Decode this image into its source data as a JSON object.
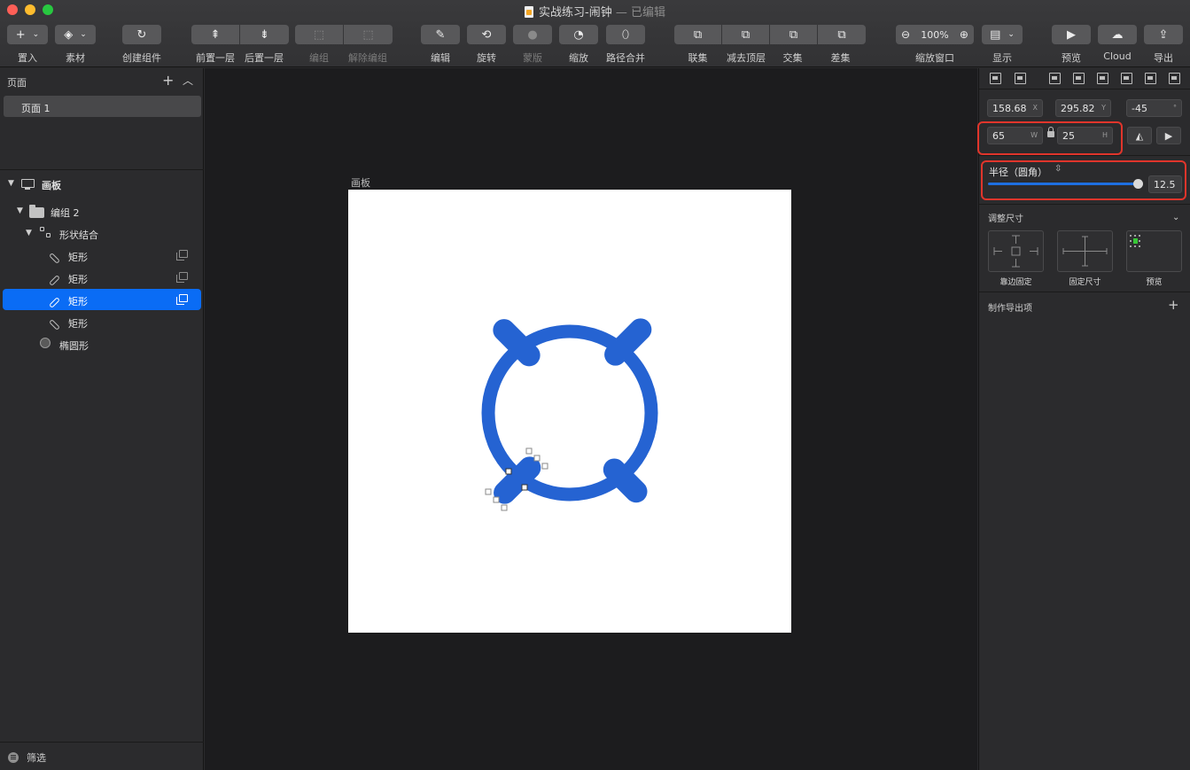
{
  "window": {
    "title": "实战练习-闹钟",
    "status": "— 已编辑"
  },
  "toolbar": {
    "insert": "置入",
    "assets": "素材",
    "create_symbol": "创建组件",
    "forward": "前置一层",
    "backward": "后置一层",
    "group": "编组",
    "ungroup": "解除编组",
    "edit": "编辑",
    "rotate": "旋转",
    "mask": "蒙版",
    "scale": "缩放",
    "flatten": "路径合并",
    "union": "联集",
    "subtract": "减去顶层",
    "intersect": "交集",
    "difference": "差集",
    "zoom_label": "缩放窗口",
    "zoom_value": "100%",
    "view": "显示",
    "preview": "预览",
    "cloud": "Cloud",
    "export": "导出"
  },
  "pages": {
    "title": "页面",
    "items": [
      "页面 1"
    ]
  },
  "layers": {
    "artboard": "画板",
    "group": "编组 2",
    "combined_shape": "形状结合",
    "rects": [
      "矩形",
      "矩形",
      "矩形",
      "矩形"
    ],
    "oval": "椭圆形",
    "filter": "筛选"
  },
  "canvas": {
    "artboard_label": "画板",
    "shape_color": "#2563d2"
  },
  "inspector": {
    "x": "158.68",
    "x_unit": "X",
    "y": "295.82",
    "y_unit": "Y",
    "rotation": "-45",
    "rotation_unit": "°",
    "width": "65",
    "width_unit": "W",
    "height": "25",
    "height_unit": "H",
    "radius_title": "半径（圆角）",
    "radius_value": "12.5",
    "resizing_title": "调整尺寸",
    "pin_to_edge": "靠边固定",
    "fix_size": "固定尺寸",
    "preview": "预览",
    "make_exportable": "制作导出项"
  }
}
